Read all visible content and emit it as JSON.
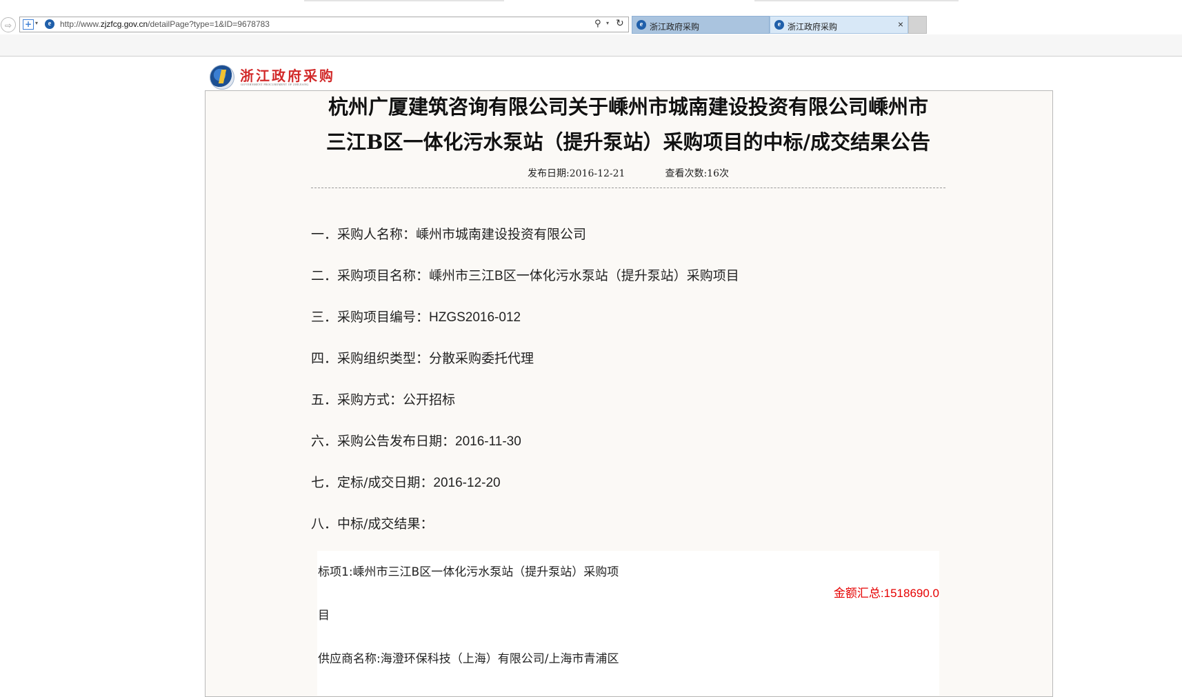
{
  "browser": {
    "url_prefix": "http://www.",
    "url_domain": "zjzfcg.gov.cn",
    "url_path": "/detailPage?type=1&ID=9678783",
    "tabs": [
      {
        "label": "浙江政府采购"
      },
      {
        "label": "浙江政府采购"
      }
    ],
    "icons": {
      "back": "back-arrow-icon",
      "compat": "compatibility-view-icon",
      "search": "search-icon",
      "refresh": "refresh-icon",
      "close": "close-icon"
    }
  },
  "site": {
    "logo_title": "浙江政府采购",
    "logo_subtitle": "GOVERNMENT PROCUREMENT OF ZHEJIANG"
  },
  "notice": {
    "title_line1": "杭州广厦建筑咨询有限公司关于嵊州市城南建设投资有限公司嵊州市",
    "title_line2": "三江B区一体化污水泵站（提升泵站）采购项目的中标/成交结果公告",
    "publish_date": "发布日期:2016-12-21",
    "view_count": "查看次数:16次",
    "fields": [
      {
        "label": "一．采购人名称：",
        "value": "嵊州市城南建设投资有限公司"
      },
      {
        "label": "二．采购项目名称：",
        "value": "嵊州市三江B区一体化污水泵站（提升泵站）采购项目"
      },
      {
        "label": "三．采购项目编号：",
        "value": "HZGS2016-012"
      },
      {
        "label": "四．采购组织类型：",
        "value": "分散采购委托代理"
      },
      {
        "label": "五．采购方式：",
        "value": "公开招标"
      },
      {
        "label": "六．采购公告发布日期：",
        "value": "2016-11-30"
      },
      {
        "label": "七．定标/成交日期：",
        "value": "2016-12-20"
      },
      {
        "label": "八．中标/成交结果：",
        "value": ""
      }
    ],
    "result": {
      "lot_name": "标项1:嵊州市三江B区一体化污水泵站（提升泵站）采购项",
      "lot_name_wrap": "目",
      "amount_total": "金额汇总:1518690.0",
      "supplier": "供应商名称:海澄环保科技（上海）有限公司/上海市青浦区"
    },
    "colors": {
      "amount": "#e60000",
      "frame_bg": "#fbf9f6",
      "logo_red": "#d22a2a"
    }
  }
}
